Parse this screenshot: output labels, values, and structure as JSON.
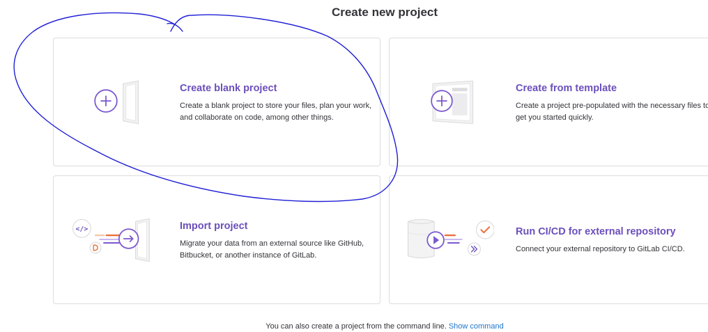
{
  "page": {
    "title": "Create new project"
  },
  "cards": {
    "blank": {
      "title": "Create blank project",
      "description": "Create a blank project to store your files, plan your work, and collaborate on code, among other things.",
      "icon": "plus-circle-icon"
    },
    "template": {
      "title": "Create from template",
      "description": "Create a project pre-populated with the necessary files to get you started quickly.",
      "icon": "plus-circle-icon"
    },
    "import": {
      "title": "Import project",
      "description": "Migrate your data from an external source like GitHub, Bitbucket, or another instance of GitLab.",
      "icon": "arrow-right-circle-icon",
      "badge_code": "</>"
    },
    "cicd": {
      "title": "Run CI/CD for external repository",
      "description": "Connect your external repository to GitLab CI/CD.",
      "icon": "play-circle-icon"
    }
  },
  "footer": {
    "text": "You can also create a project from the command line.",
    "link": "Show command"
  },
  "colors": {
    "accent": "#6b4fbb",
    "link": "#1f75cb",
    "border": "#dcdcde",
    "annotation": "#1f1fd6",
    "orange": "#e9703a"
  }
}
